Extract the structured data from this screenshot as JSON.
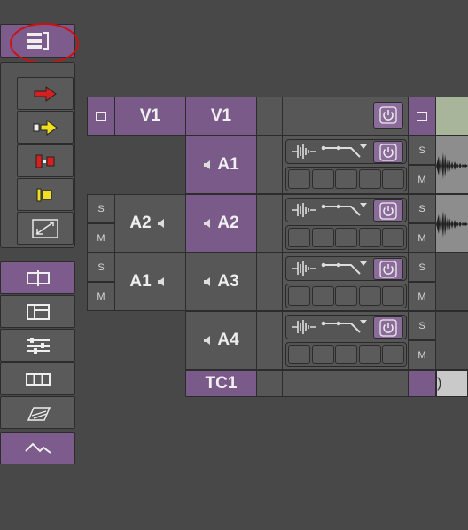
{
  "toolbar_top": {
    "tracks_menu_icon": "track-list-menu-icon",
    "highlight": "#cc1111"
  },
  "editing_tools": [
    {
      "name": "red-arrow-tool-icon",
      "color": "#d62020"
    },
    {
      "name": "yellow-arrow-tool-icon",
      "color": "#f0e020"
    },
    {
      "name": "red-splice-tool-icon",
      "color": "#d62020"
    },
    {
      "name": "yellow-segment-tool-icon",
      "color": "#f0e020"
    },
    {
      "name": "trim-tool-icon",
      "color": "#e0e0e0"
    }
  ],
  "view_tools": [
    {
      "name": "timeline-view-icon",
      "active": true
    },
    {
      "name": "sequence-view-icon",
      "active": false
    },
    {
      "name": "audio-mixer-icon",
      "active": false
    },
    {
      "name": "grid-view-icon",
      "active": false
    },
    {
      "name": "effect-view-icon",
      "active": false
    }
  ],
  "bottom_tool": {
    "name": "waveform-toggle-icon",
    "active": true
  },
  "tracks": {
    "video": {
      "source": "V1",
      "record": "V1"
    },
    "audio": [
      {
        "source": "",
        "record": "A1",
        "solo": "S",
        "mute": "M"
      },
      {
        "source": "A2",
        "record": "A2",
        "solo": "S",
        "mute": "M"
      },
      {
        "source": "A1",
        "record": "A3",
        "solo": "S",
        "mute": "M"
      },
      {
        "source": "",
        "record": "A4",
        "solo": "S",
        "mute": "M"
      }
    ],
    "timecode": "TC1",
    "left_sm": [
      {
        "s": "S",
        "m": "M"
      },
      {
        "s": "S",
        "m": "M"
      }
    ]
  },
  "colors": {
    "accent": "#7a5a89",
    "panel": "#555555",
    "bg": "#484848"
  }
}
